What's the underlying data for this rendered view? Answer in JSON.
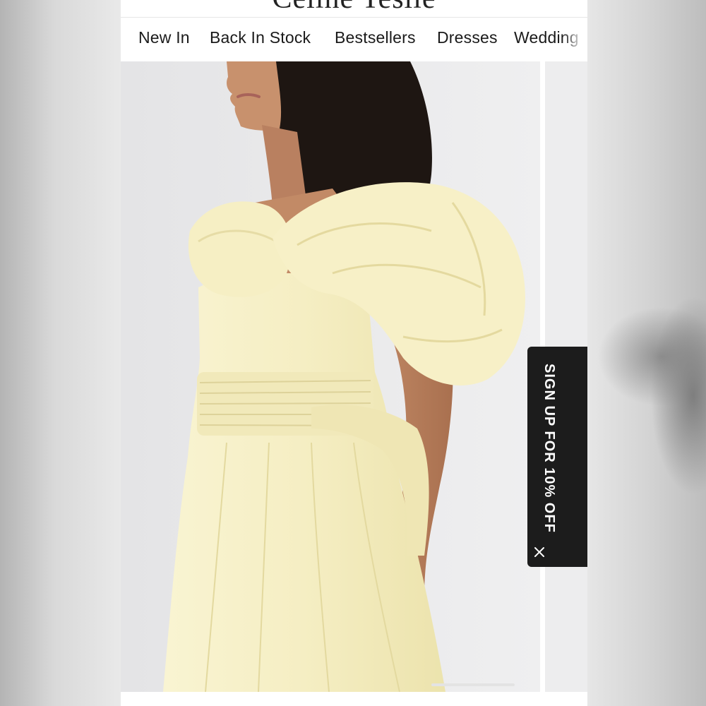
{
  "header": {
    "logo_text": "Celine Teslie"
  },
  "nav": {
    "items": [
      {
        "label": "New In"
      },
      {
        "label": "Back In Stock"
      },
      {
        "label": "Bestsellers"
      },
      {
        "label": "Dresses"
      },
      {
        "label": "Wedding"
      }
    ]
  },
  "promo": {
    "signup_label": "SIGN UP FOR 10% OFF",
    "close_icon": "close-icon"
  },
  "product_gallery": {
    "image_subject": "model-in-pale-yellow-puff-sleeve-dress",
    "colors": {
      "dress": "#f7f1c8",
      "skin": "#c08662",
      "hair": "#1e1612",
      "background": "#eaeaec"
    }
  }
}
